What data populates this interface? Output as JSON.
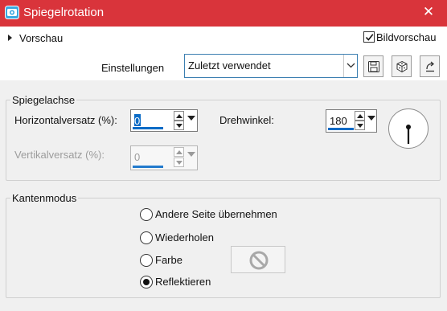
{
  "titlebar": {
    "title": "Spiegelrotation",
    "close_glyph": "✕",
    "app_icon": "camera-icon"
  },
  "preview": {
    "toggle_label": "Vorschau",
    "checkbox_label": "Bildvorschau",
    "checked": true
  },
  "settings": {
    "label": "Einstellungen",
    "selected": "Zuletzt verwendet",
    "buttons": [
      "save-preset-icon",
      "randomize-icon",
      "reset-icon"
    ]
  },
  "mirror_axis": {
    "group_label": "Spiegelachse",
    "horizontal_label": "Horizontalversatz (%):",
    "horizontal_value": "0",
    "vertical_label": "Vertikalversatz (%):",
    "vertical_value": "0",
    "angle_label": "Drehwinkel:",
    "angle_value": "180"
  },
  "edge_mode": {
    "group_label": "Kantenmodus",
    "options": [
      {
        "label": "Andere Seite übernehmen",
        "selected": false
      },
      {
        "label": "Wiederholen",
        "selected": false
      },
      {
        "label": "Farbe",
        "selected": false
      },
      {
        "label": "Reflektieren",
        "selected": true
      }
    ],
    "color_swatch_icon": "no-color-icon"
  },
  "colors": {
    "title_bar": "#d9343b",
    "accent": "#0a6bc6",
    "dialog_bg": "#f0f0f0"
  }
}
